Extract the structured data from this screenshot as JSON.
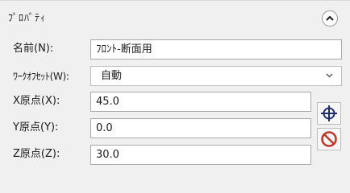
{
  "header": {
    "title": "ﾌﾟﾛﾊﾟﾃｨ"
  },
  "fields": {
    "name": {
      "label": "名前(N):",
      "value": "ﾌﾛﾝﾄ-断面用"
    },
    "work_offset": {
      "label": "ﾜｰｸｵﾌｾｯﾄ(W):",
      "value": "自動"
    },
    "x": {
      "label": "X原点(X):",
      "value": "45.0"
    },
    "y": {
      "label": "Y原点(Y):",
      "value": "0.0"
    },
    "z": {
      "label": "Z原点(Z):",
      "value": "30.0"
    }
  },
  "icons": {
    "collapse": "chevron-up-icon",
    "pick_origin": "crosshair-icon",
    "clear_origin": "no-entry-icon"
  },
  "colors": {
    "accent_red": "#c0392b"
  }
}
